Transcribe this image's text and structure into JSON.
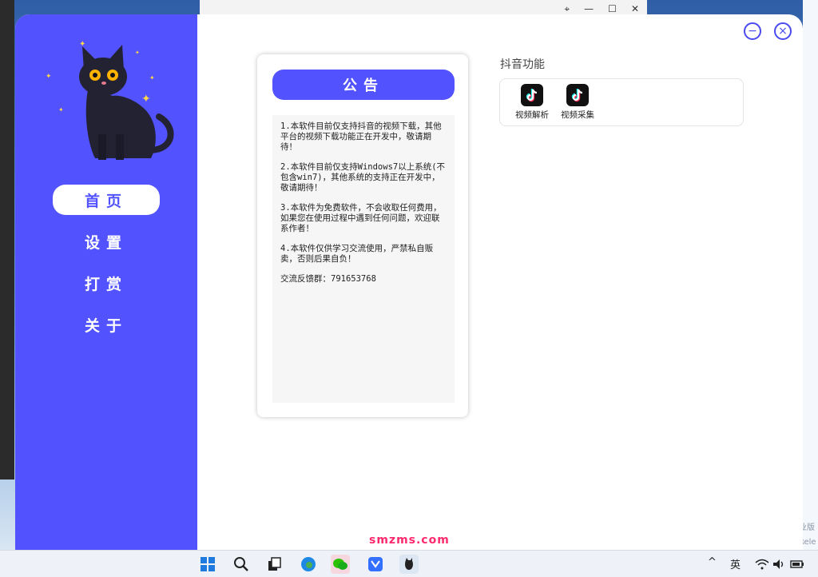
{
  "app": {
    "nav": [
      {
        "label": "首页",
        "active": true
      },
      {
        "label": "设置",
        "active": false
      },
      {
        "label": "打赏",
        "active": false
      },
      {
        "label": "关于",
        "active": false
      }
    ],
    "window_buttons": {
      "minimize": "−",
      "close": "×"
    },
    "accent_color": "#5252ff"
  },
  "notice": {
    "title": "公告",
    "paragraphs": [
      "1.本软件目前仅支持抖音的视频下载，其他平台的视频下载功能正在开发中，敬请期待！",
      "2.本软件目前仅支持Windows7以上系统(不包含win7)，其他系统的支持正在开发中，敬请期待！",
      "3.本软件为免费软件，不会收取任何费用，如果您在使用过程中遇到任何问题，欢迎联系作者！",
      "4.本软件仅供学习交流使用，严禁私自贩卖，否则后果自负！",
      "交流反馈群：791653768"
    ]
  },
  "features": {
    "title": "抖音功能",
    "items": [
      {
        "label": "视频解析",
        "icon": "tiktok-icon"
      },
      {
        "label": "视频采集",
        "icon": "tiktok-icon"
      }
    ]
  },
  "background_window": {
    "controls": [
      "⌖",
      "—",
      "☐",
      "✕"
    ]
  },
  "taskbar": {
    "site_badge": "smzms.com",
    "ime": "英",
    "tray_chevron": "^"
  },
  "watermark": "业版 Rele"
}
